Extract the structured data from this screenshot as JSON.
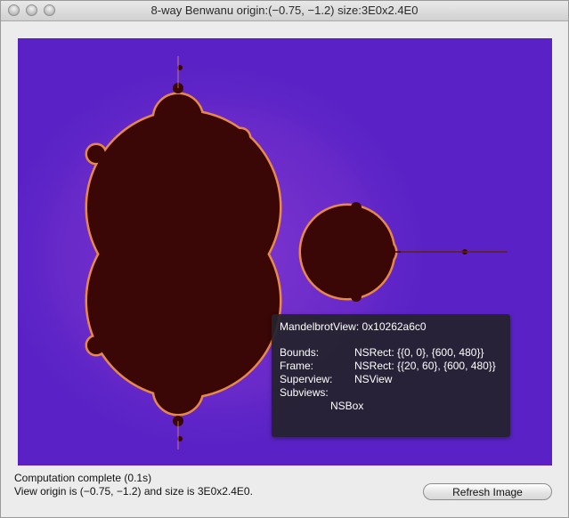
{
  "window": {
    "title": "8-way Benwanu origin:(−0.75, −1.2) size:3E0x2.4E0"
  },
  "tooltip": {
    "title": "MandelbrotView: 0x10262a6c0",
    "rows": [
      {
        "key": "Bounds:",
        "value": "NSRect: {{0, 0}, {600, 480}}"
      },
      {
        "key": "Frame:",
        "value": "NSRect: {{20, 60}, {600, 480}}"
      },
      {
        "key": "Superview:",
        "value": "NSView"
      },
      {
        "key": "Subviews:",
        "value": ""
      }
    ],
    "subview": "NSBox"
  },
  "status": {
    "line1": "Computation complete (0.1s)",
    "line2": "View origin is (−0.75, −1.2) and size is 3E0x2.4E0."
  },
  "buttons": {
    "refresh": "Refresh Image"
  },
  "colors": {
    "background": "#5a22c6",
    "set": "#3a0606",
    "glow": "#ff9a2e"
  }
}
